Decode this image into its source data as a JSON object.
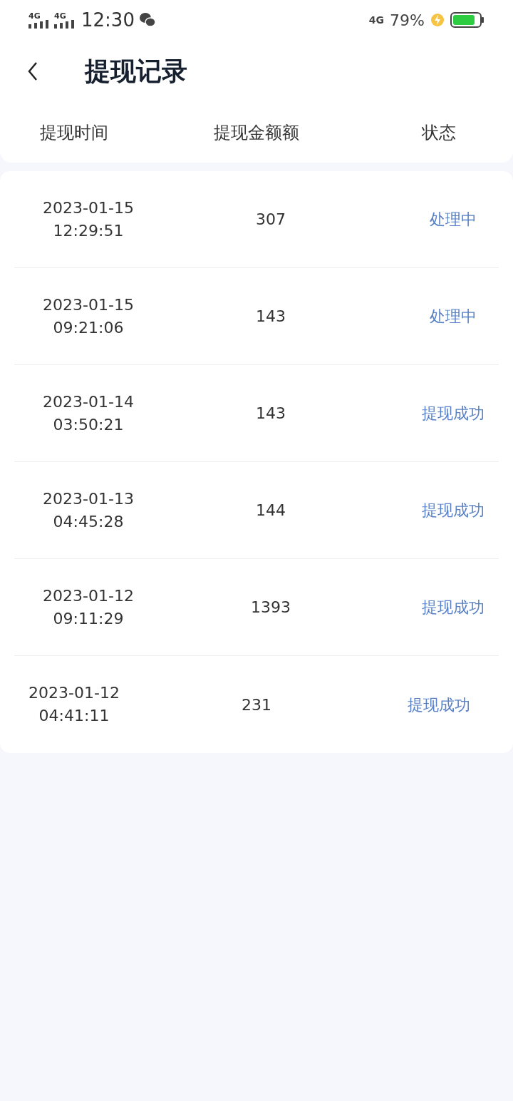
{
  "status_bar": {
    "signal_labels": [
      "4G",
      "4G"
    ],
    "time": "12:30",
    "network": "4G",
    "battery": "79%"
  },
  "nav": {
    "title": "提现记录"
  },
  "table": {
    "columns": [
      "提现时间",
      "提现金额额",
      "状态"
    ],
    "rows": [
      {
        "date": "2023-01-15",
        "time": "12:29:51",
        "amount": "307",
        "status": "处理中"
      },
      {
        "date": "2023-01-15",
        "time": "09:21:06",
        "amount": "143",
        "status": "处理中"
      },
      {
        "date": "2023-01-14",
        "time": "03:50:21",
        "amount": "143",
        "status": "提现成功"
      },
      {
        "date": "2023-01-13",
        "time": "04:45:28",
        "amount": "144",
        "status": "提现成功"
      },
      {
        "date": "2023-01-12",
        "time": "09:11:29",
        "amount": "1393",
        "status": "提现成功"
      },
      {
        "date": "2023-01-12",
        "time": "04:41:11",
        "amount": "231",
        "status": "提现成功"
      }
    ]
  }
}
